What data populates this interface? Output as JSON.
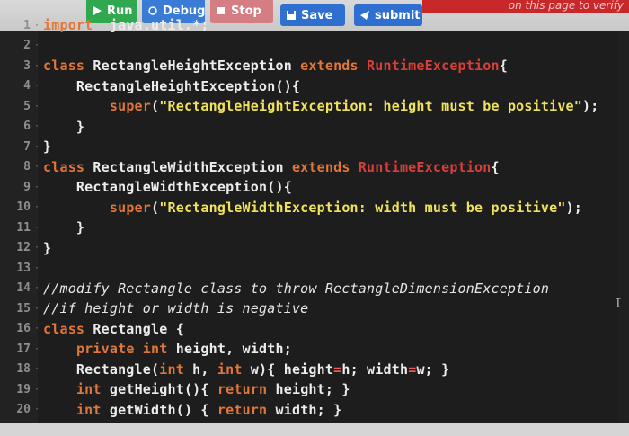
{
  "toolbar": {
    "run_label": "Run",
    "debug_label": "Debug",
    "stop_label": "Stop",
    "save_label": "Save",
    "submit_label": "submit",
    "notice": "on this page to verify"
  },
  "lines": [
    {
      "n": "1",
      "segs": [
        [
          "kw",
          "import"
        ],
        [
          "",
          "  java.util.*;"
        ]
      ]
    },
    {
      "n": "2",
      "segs": []
    },
    {
      "n": "3",
      "segs": [
        [
          "kw",
          "class"
        ],
        [
          "",
          " RectangleHeightException "
        ],
        [
          "kw",
          "extends"
        ],
        [
          "",
          " "
        ],
        [
          "kw2",
          "RuntimeException"
        ],
        [
          "",
          "{"
        ]
      ]
    },
    {
      "n": "4",
      "segs": [
        [
          "",
          "    RectangleHeightException(){"
        ]
      ]
    },
    {
      "n": "5",
      "segs": [
        [
          "",
          "        "
        ],
        [
          "kw",
          "super"
        ],
        [
          "",
          "("
        ],
        [
          "str",
          "\"RectangleHeightException: height must be positive\""
        ],
        [
          "",
          ");"
        ]
      ]
    },
    {
      "n": "6",
      "segs": [
        [
          "",
          "    }"
        ]
      ]
    },
    {
      "n": "7",
      "segs": [
        [
          "",
          "}"
        ]
      ]
    },
    {
      "n": "8",
      "segs": [
        [
          "kw",
          "class"
        ],
        [
          "",
          " RectangleWidthException "
        ],
        [
          "kw",
          "extends"
        ],
        [
          "",
          " "
        ],
        [
          "kw2",
          "RuntimeException"
        ],
        [
          "",
          "{"
        ]
      ]
    },
    {
      "n": "9",
      "segs": [
        [
          "",
          "    RectangleWidthException(){"
        ]
      ]
    },
    {
      "n": "10",
      "segs": [
        [
          "",
          "        "
        ],
        [
          "kw",
          "super"
        ],
        [
          "",
          "("
        ],
        [
          "str",
          "\"RectangleWidthException: width must be positive\""
        ],
        [
          "",
          ");"
        ]
      ]
    },
    {
      "n": "11",
      "segs": [
        [
          "",
          "    }"
        ]
      ]
    },
    {
      "n": "12",
      "segs": [
        [
          "",
          "}"
        ]
      ]
    },
    {
      "n": "13",
      "segs": []
    },
    {
      "n": "14",
      "segs": [
        [
          "cm",
          "//modify Rectangle class to throw RectangleDimensionException"
        ]
      ]
    },
    {
      "n": "15",
      "segs": [
        [
          "cm",
          "//if height or width is negative"
        ]
      ]
    },
    {
      "n": "16",
      "segs": [
        [
          "kw",
          "class"
        ],
        [
          "",
          " Rectangle {"
        ]
      ]
    },
    {
      "n": "17",
      "segs": [
        [
          "",
          "    "
        ],
        [
          "kw",
          "private"
        ],
        [
          "",
          " "
        ],
        [
          "kw",
          "int"
        ],
        [
          "",
          " height, width;"
        ]
      ]
    },
    {
      "n": "18",
      "segs": [
        [
          "",
          "    Rectangle("
        ],
        [
          "kw",
          "int"
        ],
        [
          "",
          " h, "
        ],
        [
          "kw",
          "int"
        ],
        [
          "",
          " w){ height"
        ],
        [
          "sym",
          "="
        ],
        [
          "",
          "h; width"
        ],
        [
          "sym",
          "="
        ],
        [
          "",
          "w; }"
        ]
      ]
    },
    {
      "n": "19",
      "segs": [
        [
          "",
          "    "
        ],
        [
          "kw",
          "int"
        ],
        [
          "",
          " getHeight(){ "
        ],
        [
          "kw",
          "return"
        ],
        [
          "",
          " height; }"
        ]
      ]
    },
    {
      "n": "20",
      "segs": [
        [
          "",
          "    "
        ],
        [
          "kw",
          "int"
        ],
        [
          "",
          " getWidth() { "
        ],
        [
          "kw",
          "return"
        ],
        [
          "",
          " width; }"
        ]
      ]
    }
  ],
  "colors": {
    "background": "#1d1d1d",
    "keyword": "#e0763a",
    "type": "#d6403a",
    "string": "#f0e25a",
    "run_button": "#2fa84f",
    "save_button": "#2f6fd0"
  }
}
